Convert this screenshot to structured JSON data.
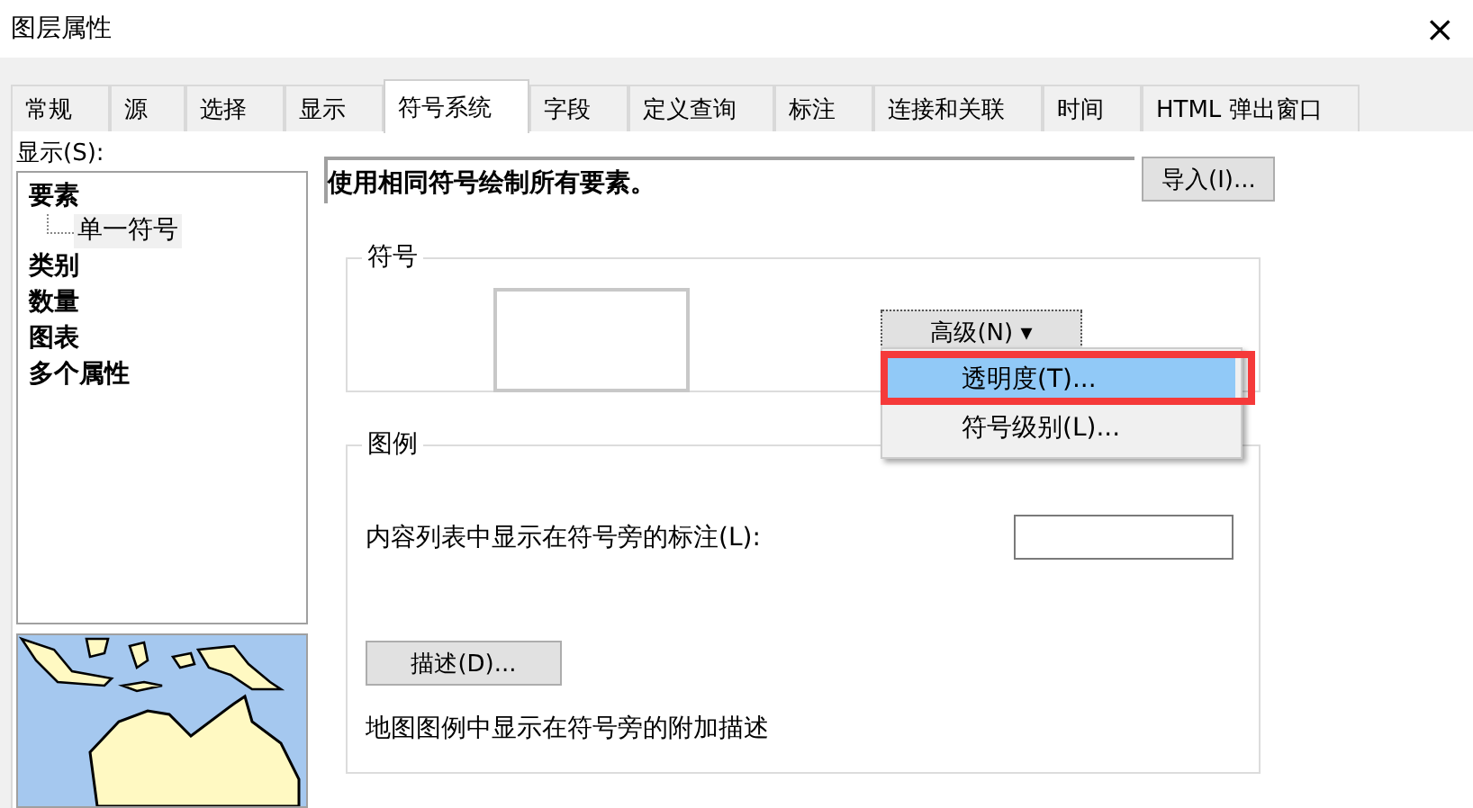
{
  "window": {
    "title": "图层属性",
    "close": "×"
  },
  "tabs": [
    {
      "label": "常规",
      "selected": false
    },
    {
      "label": "源",
      "selected": false
    },
    {
      "label": "选择",
      "selected": false
    },
    {
      "label": "显示",
      "selected": false
    },
    {
      "label": "符号系统",
      "selected": true
    },
    {
      "label": "字段",
      "selected": false
    },
    {
      "label": "定义查询",
      "selected": false
    },
    {
      "label": "标注",
      "selected": false
    },
    {
      "label": "连接和关联",
      "selected": false
    },
    {
      "label": "时间",
      "selected": false
    },
    {
      "label": "HTML 弹出窗口",
      "selected": false
    }
  ],
  "sidebar": {
    "label": "显示(S):",
    "items": [
      {
        "label": "要素",
        "children": [
          {
            "label": "单一符号",
            "selected": true
          }
        ]
      },
      {
        "label": "类别"
      },
      {
        "label": "数量"
      },
      {
        "label": "图表"
      },
      {
        "label": "多个属性"
      }
    ]
  },
  "description": "使用相同符号绘制所有要素。",
  "import_button": "导入(I)...",
  "symbol_group": {
    "title": "符号",
    "advanced_button": "高级(N)",
    "caret": "▾"
  },
  "advanced_menu": {
    "items": [
      {
        "label": "透明度(T)...",
        "selected": true,
        "highlighted": true
      },
      {
        "label": "符号级别(L)...",
        "selected": false,
        "highlighted": false
      }
    ]
  },
  "legend_group": {
    "title": "图例",
    "label_caption": "内容列表中显示在符号旁的标注(L):",
    "description_button": "描述(D)...",
    "description_caption": "地图图例中显示在符号旁的附加描述"
  }
}
